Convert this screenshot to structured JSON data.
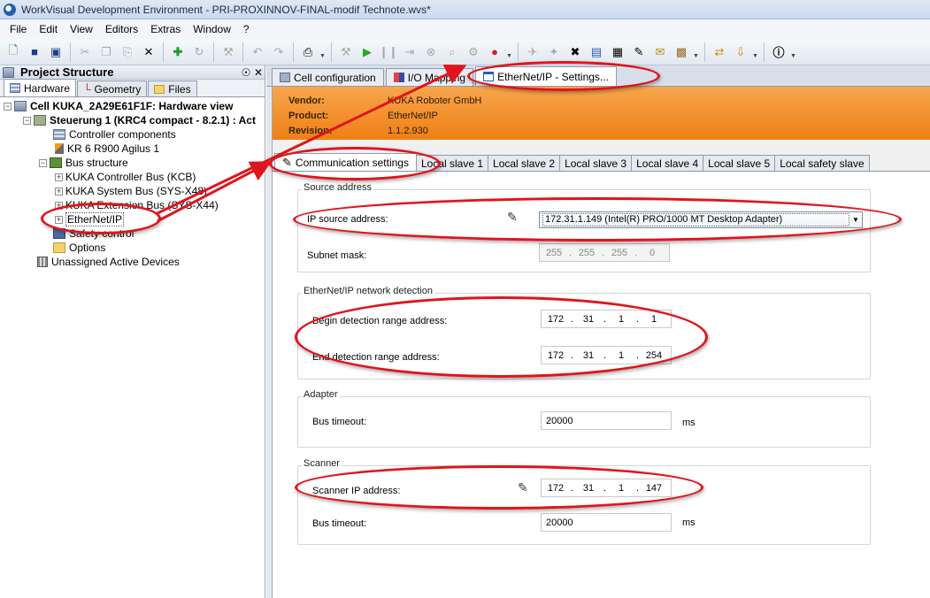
{
  "window": {
    "title": "WorkVisual Development Environment - PRI-PROXINNOV-FINAL-modif Technote.wvs*"
  },
  "menu": [
    "File",
    "Edit",
    "View",
    "Editors",
    "Extras",
    "Window",
    "?"
  ],
  "toolbar": {
    "icons": [
      "new-icon",
      "save-icon",
      "save-all-icon",
      "cut-icon",
      "copy-icon",
      "paste-icon",
      "delete-icon",
      "add-icon",
      "replace-icon",
      "build-icon",
      "undo-icon",
      "redo-icon",
      "import-icon",
      "tools-icon",
      "play-icon",
      "pause-icon",
      "step-icon",
      "stop-icon",
      "search-icon",
      "settings-icon",
      "record-icon",
      "robot-icon",
      "wizard-icon",
      "config-icon",
      "lock-icon",
      "chart-icon",
      "edit-icon",
      "note-icon",
      "package-icon",
      "transfer-icon",
      "deploy-icon",
      "help-icon"
    ]
  },
  "project_structure": {
    "title": "Project Structure",
    "pin_glyph": "☉",
    "close_glyph": "✕",
    "tabs": [
      "Hardware",
      "Geometry",
      "Files"
    ],
    "tree": [
      {
        "label": "Cell KUKA_2A29E61F1F: Hardware view",
        "icon": "cell-icon"
      },
      {
        "label": "Steuerung 1 (KRC4 compact - 8.2.1) : Act",
        "icon": "controller-icon"
      },
      {
        "label": "Controller components",
        "icon": "components-icon"
      },
      {
        "label": "KR 6 R900 Agilus 1",
        "icon": "robot-icon"
      },
      {
        "label": "Bus structure",
        "icon": "bus-structure-icon"
      },
      {
        "label": "KUKA Controller Bus (KCB)",
        "icon": "bus-icon"
      },
      {
        "label": "KUKA System Bus (SYS-X48)",
        "icon": "bus-icon"
      },
      {
        "label": "KUKA Extension Bus (SYS-X44)",
        "icon": "bus-icon"
      },
      {
        "label": "EtherNet/IP",
        "icon": "bus-icon"
      },
      {
        "label": "Safety control",
        "icon": "safety-icon"
      },
      {
        "label": "Options",
        "icon": "folder-icon"
      },
      {
        "label": "Unassigned Active Devices",
        "icon": "unassigned-icon"
      }
    ]
  },
  "document_tabs": [
    "Cell configuration",
    "I/O Mapping",
    "EtherNet/IP - Settings..."
  ],
  "device_info": {
    "vendor_label": "Vendor:",
    "vendor": "KUKA Roboter GmbH",
    "product_label": "Product:",
    "product": "EtherNet/IP",
    "revision_label": "Revision:",
    "revision": "1.1.2.930"
  },
  "sub_tabs": [
    "Communication settings",
    "Local slave 1",
    "Local slave 2",
    "Local slave 3",
    "Local slave 4",
    "Local slave 5",
    "Local safety slave"
  ],
  "source_address": {
    "title": "Source address",
    "ip_label": "IP source address:",
    "ip_value": "172.31.1.149 (Intel(R) PRO/1000 MT Desktop Adapter)",
    "subnet_label": "Subnet mask:",
    "subnet": [
      "255",
      "255",
      "255",
      "0"
    ]
  },
  "network_detection": {
    "title": "EtherNet/IP network detection",
    "begin_label": "Begin detection range address:",
    "begin": [
      "172",
      "31",
      "1",
      "1"
    ],
    "end_label": "End detection range address:",
    "end": [
      "172",
      "31",
      "1",
      "254"
    ]
  },
  "adapter": {
    "title": "Adapter",
    "timeout_label": "Bus timeout:",
    "timeout": "20000",
    "unit": "ms"
  },
  "scanner": {
    "title": "Scanner",
    "ip_label": "Scanner IP address:",
    "ip": [
      "172",
      "31",
      "1",
      "147"
    ],
    "timeout_label": "Bus timeout:",
    "timeout": "20000",
    "unit": "ms"
  },
  "colors": {
    "header_orange": "#ef7f16",
    "annotation_red": "#e0141c"
  }
}
